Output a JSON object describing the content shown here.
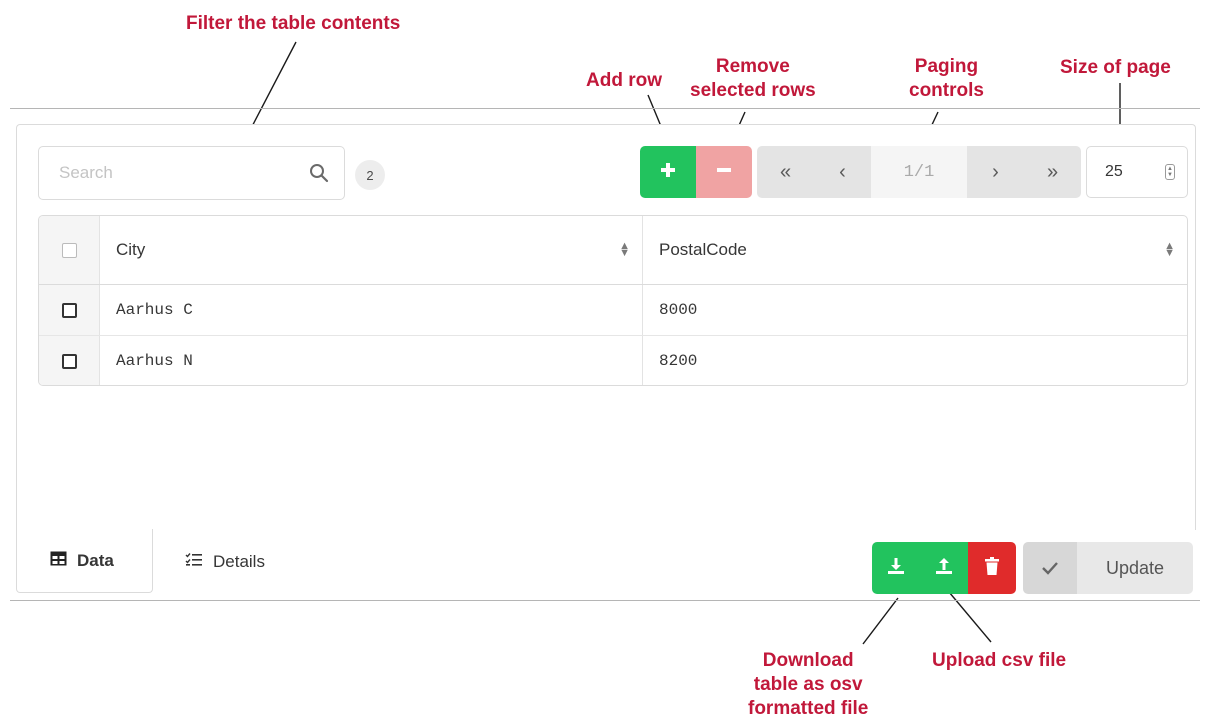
{
  "annotations": {
    "filter": "Filter the table contents",
    "add_row": "Add row",
    "remove_line1": "Remove",
    "remove_line2": "selected rows",
    "paging_line1": "Paging",
    "paging_line2": "controls",
    "page_size": "Size of page",
    "download_line1": "Download",
    "download_line2": "table as osv",
    "download_line3": "formatted file",
    "upload": "Upload csv file"
  },
  "search": {
    "placeholder": "Search",
    "value": "",
    "icon": "search-icon",
    "row_count": "2"
  },
  "toolbar": {
    "add_icon": "plus-icon",
    "remove_icon": "minus-icon"
  },
  "paging": {
    "first": "«",
    "prev": "‹",
    "info": "1/1",
    "next": "›",
    "last": "»"
  },
  "page_size": {
    "value": "25"
  },
  "table": {
    "columns": [
      "City",
      "PostalCode"
    ],
    "rows": [
      {
        "city": "Aarhus C",
        "postal": "8000"
      },
      {
        "city": "Aarhus N",
        "postal": "8200"
      }
    ]
  },
  "tabs": [
    {
      "label": "Data",
      "icon": "table-icon",
      "active": true
    },
    {
      "label": "Details",
      "icon": "checklist-icon",
      "active": false
    }
  ],
  "actions": {
    "download_icon": "download-icon",
    "upload_icon": "upload-icon",
    "delete_icon": "trash-icon",
    "update_label": "Update",
    "update_icon": "check-icon"
  },
  "colors": {
    "annotation": "#c1183a",
    "success": "#22c35e",
    "danger_light": "#f0a3a3",
    "danger": "#e02b2b"
  }
}
